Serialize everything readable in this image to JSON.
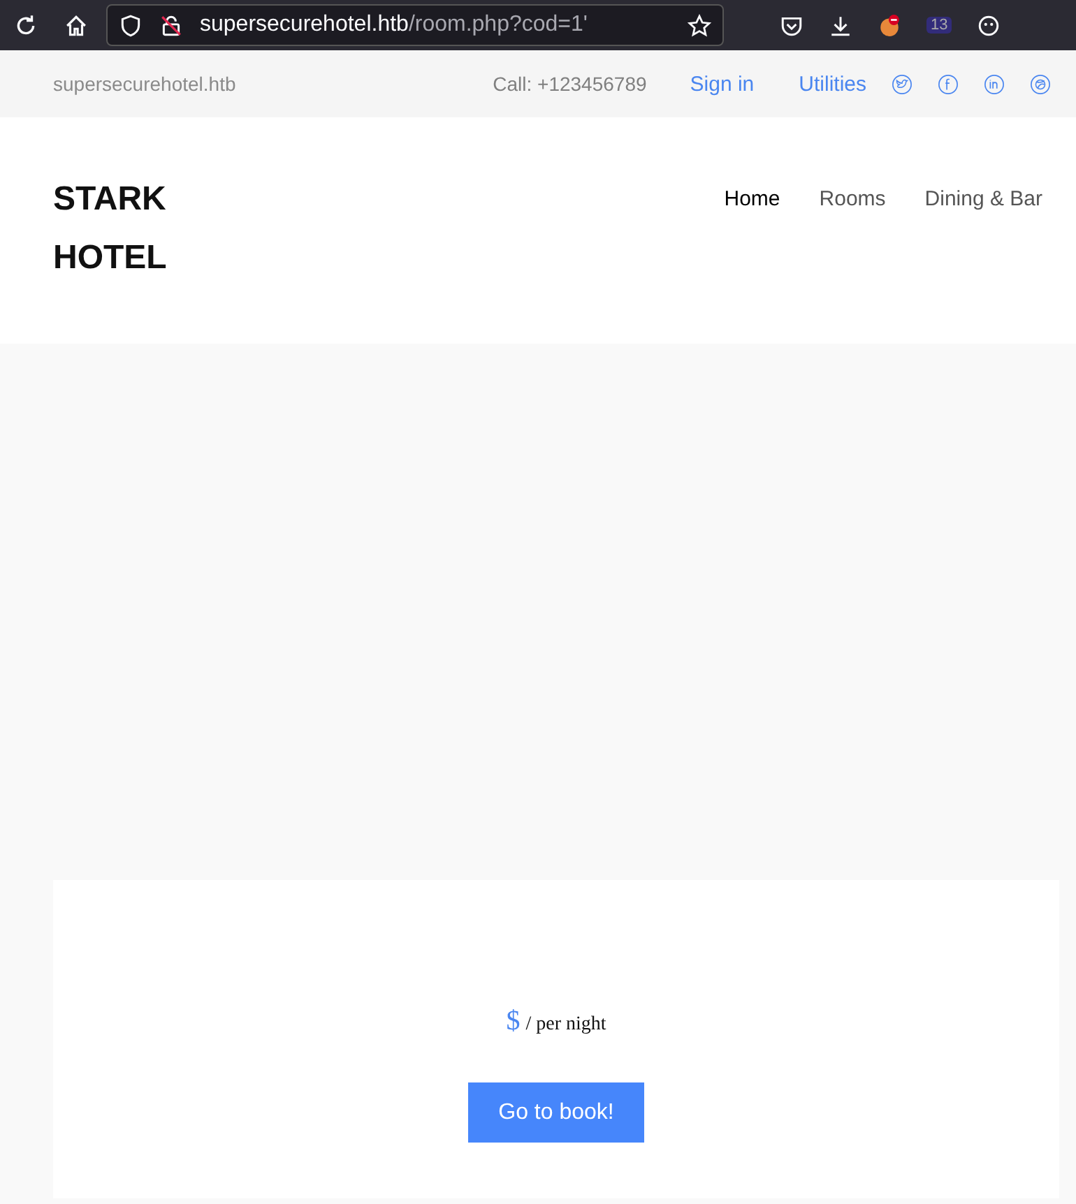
{
  "browser": {
    "url_host": "supersecurehotel.htb",
    "url_path": "/room.php?cod=1'",
    "badge": "13"
  },
  "topbar": {
    "site": "supersecurehotel.htb",
    "phone": "Call: +123456789",
    "links": [
      "Sign in",
      "Utilities"
    ],
    "social": [
      {
        "kind": "twitter"
      },
      {
        "kind": "facebook"
      },
      {
        "kind": "linkedin"
      },
      {
        "kind": "dribbble"
      }
    ]
  },
  "header": {
    "logo": "STARK HOTEL",
    "nav": [
      {
        "label": "Home",
        "selected": true
      },
      {
        "label": "Rooms",
        "selected": false
      },
      {
        "label": "Dining & Bar",
        "selected": false
      }
    ]
  },
  "room": {
    "currency": "$",
    "price_suffix": "/ per night",
    "button": "Go to book!"
  }
}
